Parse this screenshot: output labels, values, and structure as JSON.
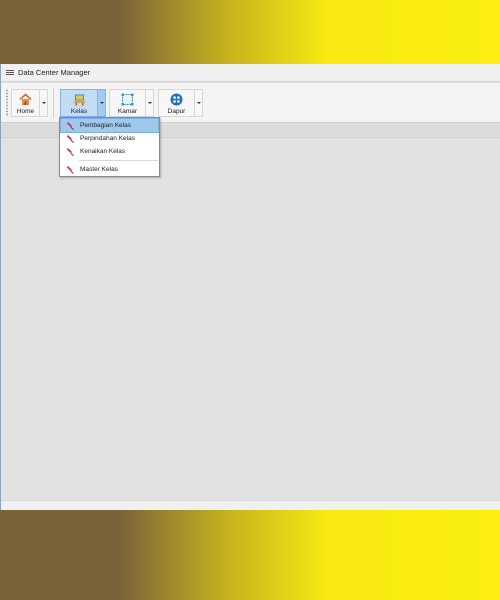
{
  "window": {
    "title": "Data Center Manager"
  },
  "toolbar": {
    "buttons": [
      {
        "label": "Home",
        "icon": "home-icon"
      },
      {
        "label": "Kelas",
        "icon": "classroom-icon",
        "active": true
      },
      {
        "label": "Kamar",
        "icon": "room-icon"
      },
      {
        "label": "Dapur",
        "icon": "kitchen-icon"
      }
    ]
  },
  "kelas_menu": {
    "items": [
      {
        "label": "Pembagian Kelas",
        "icon": "pin-icon",
        "selected": true
      },
      {
        "label": "Perpindahan Kelas",
        "icon": "pin-icon"
      },
      {
        "label": "Kenaikan Kelas",
        "icon": "pin-icon"
      },
      {
        "label": "Master Kelas",
        "icon": "pin-icon"
      }
    ]
  },
  "colors": {
    "accent": "#c2dcf4",
    "selection": "#9fc8ec",
    "pin": "#d6247a"
  }
}
